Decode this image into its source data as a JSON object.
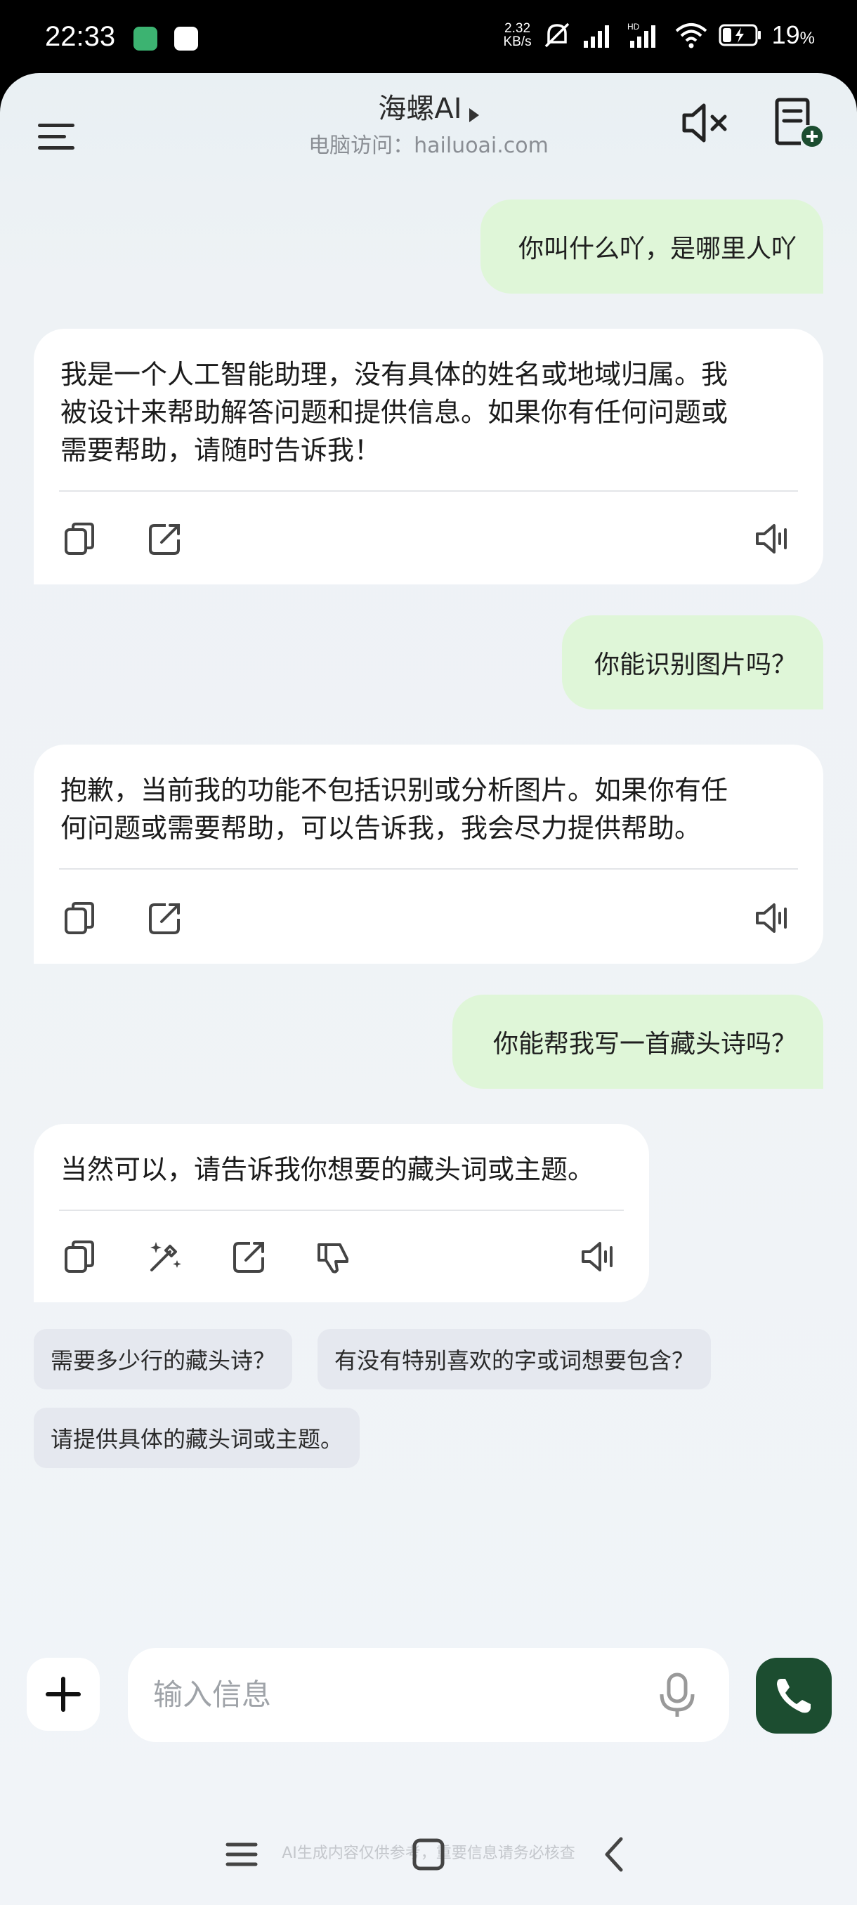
{
  "status_bar": {
    "time": "22:33",
    "net_speed_value": "2.32",
    "net_speed_unit": "KB/s",
    "battery_percent": "19",
    "battery_unit": "%"
  },
  "header": {
    "title": "海螺AI",
    "subtitle": "电脑访问：hailuoai.com"
  },
  "messages": [
    {
      "role": "user",
      "text": "你叫什么吖，是哪里人吖"
    },
    {
      "role": "assistant",
      "lines": [
        "我是一个人工智能助理，没有具体的姓名或地域归属。我",
        "被设计来帮助解答问题和提供信息。如果你有任何问题或",
        "需要帮助，请随时告诉我！"
      ]
    },
    {
      "role": "user",
      "text": "你能识别图片吗？"
    },
    {
      "role": "assistant",
      "lines": [
        "抱歉，当前我的功能不包括识别或分析图片。如果你有任",
        "何问题或需要帮助，可以告诉我，我会尽力提供帮助。"
      ]
    },
    {
      "role": "user",
      "text": "你能帮我写一首藏头诗吗？"
    },
    {
      "role": "assistant",
      "lines": [
        "当然可以，请告诉我你想要的藏头词或主题。"
      ]
    }
  ],
  "suggestions": [
    "需要多少行的藏头诗？",
    "有没有特别喜欢的字或词想要包含？",
    "请提供具体的藏头词或主题。"
  ],
  "input": {
    "placeholder": "输入信息"
  },
  "disclaimer": "AI生成内容仅供参考，重要信息请务必核查",
  "colors": {
    "user_bubble": "#dff6d8",
    "call_button": "#1c4d30",
    "chip": "#e5e8ef"
  }
}
